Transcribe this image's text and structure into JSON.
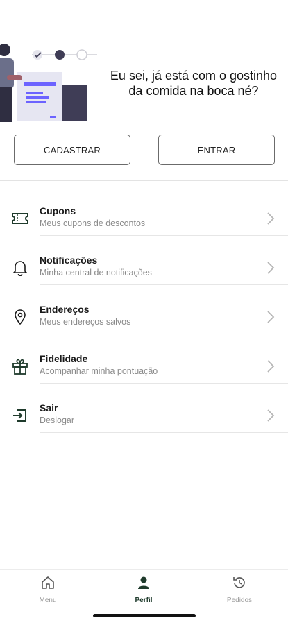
{
  "hero": {
    "text": "Eu sei, já está com o gostinho da comida na boca né?"
  },
  "auth": {
    "register_label": "CADASTRAR",
    "login_label": "ENTRAR"
  },
  "colors": {
    "accent": "#1f3b2c",
    "illustration_purple": "#6c63ff",
    "divider": "#e3e3e3"
  },
  "menu": {
    "items": [
      {
        "icon": "ticket-icon",
        "title": "Cupons",
        "subtitle": "Meus cupons de descontos"
      },
      {
        "icon": "bell-icon",
        "title": "Notificações",
        "subtitle": "Minha central de notificações"
      },
      {
        "icon": "location-pin-icon",
        "title": "Endereços",
        "subtitle": "Meus endereços salvos"
      },
      {
        "icon": "gift-icon",
        "title": "Fidelidade",
        "subtitle": "Acompanhar minha pontuação"
      },
      {
        "icon": "logout-icon",
        "title": "Sair",
        "subtitle": "Deslogar"
      }
    ]
  },
  "bottom_nav": {
    "items": [
      {
        "icon": "home-icon",
        "label": "Menu",
        "active": false
      },
      {
        "icon": "user-icon",
        "label": "Perfil",
        "active": true
      },
      {
        "icon": "history-icon",
        "label": "Pedidos",
        "active": false
      }
    ]
  }
}
